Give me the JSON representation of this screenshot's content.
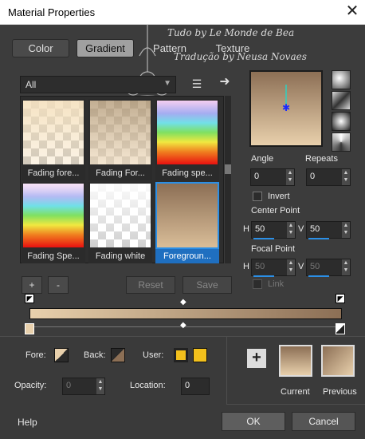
{
  "window": {
    "title": "Material Properties"
  },
  "tabs": [
    {
      "label": "Color"
    },
    {
      "label": "Gradient"
    },
    {
      "label": "Pattern"
    },
    {
      "label": "Texture"
    }
  ],
  "watermark": {
    "line1": "Tudo by Le Monde de Bea",
    "line2": "Tradução by Neusa Novaes"
  },
  "filter": {
    "selected": "All"
  },
  "gradients": [
    {
      "label": "Fading fore..."
    },
    {
      "label": "Fading For..."
    },
    {
      "label": "Fading spe..."
    },
    {
      "label": "Fading Spe..."
    },
    {
      "label": "Fading white"
    },
    {
      "label": "Foregroun..."
    }
  ],
  "list_buttons": {
    "add": "+",
    "remove": "-",
    "reset": "Reset",
    "save": "Save"
  },
  "angle": {
    "label": "Angle",
    "value": "0"
  },
  "repeats": {
    "label": "Repeats",
    "value": "0"
  },
  "invert": {
    "label": "Invert",
    "checked": false
  },
  "center_point": {
    "label": "Center Point",
    "h_label": "H",
    "h_value": "50",
    "v_label": "V",
    "v_value": "50"
  },
  "focal_point": {
    "label": "Focal Point",
    "h_label": "H",
    "h_value": "50",
    "v_label": "V",
    "v_value": "50"
  },
  "link": {
    "label": "Link",
    "checked": false
  },
  "footer": {
    "fore_label": "Fore:",
    "back_label": "Back:",
    "user_label": "User:",
    "opacity_label": "Opacity:",
    "opacity_value": "0",
    "location_label": "Location:",
    "location_value": "0",
    "current_label": "Current",
    "previous_label": "Previous",
    "add_symbol": "+"
  },
  "buttons": {
    "help": "Help",
    "ok": "OK",
    "cancel": "Cancel"
  },
  "colors": {
    "gradient_start": "#e8d0ac",
    "gradient_end": "#8c6f55",
    "user_color": "#f2c01c",
    "accent": "#2b8fe6"
  }
}
